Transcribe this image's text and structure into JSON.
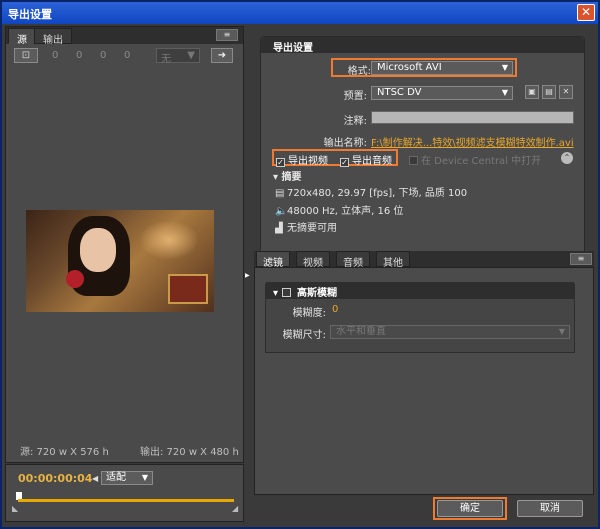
{
  "window": {
    "title": "导出设置",
    "close_glyph": "✕"
  },
  "left": {
    "tabs": [
      "源",
      "输出"
    ],
    "panel_menu_glyph": "≡",
    "crop_values": [
      "0",
      "0",
      "0",
      "0"
    ],
    "crop_ratio": "无",
    "source_size": "源: 720 w X 576 h",
    "output_size": "输出: 720 w X 480 h",
    "timecode": "00:00:00:04",
    "fit_select": "适配"
  },
  "export": {
    "section_title": "导出设置",
    "format_label": "格式:",
    "format_value": "Microsoft AVI",
    "preset_label": "预置:",
    "preset_value": "NTSC DV",
    "comment_label": "注释:",
    "output_name_label": "输出名称:",
    "output_name_value": "F:\\制作解决...特效\\视频滤支模糊特效制作.avi",
    "export_video_label": "导出视频",
    "export_audio_label": "导出音频",
    "device_central_label": "在 Device Central 中打开",
    "summary_title": "摘要",
    "summary_video": "720x480, 29.97 [fps], 下场, 品质 100",
    "summary_audio": "48000 Hz, 立体声, 16 位",
    "summary_none": "无摘要可用"
  },
  "tabs2": [
    "滤镜",
    "视频",
    "音频",
    "其他"
  ],
  "filter": {
    "name": "高斯模糊",
    "blur_label": "模糊度:",
    "blur_value": "0",
    "dimension_label": "模糊尺寸:",
    "dimension_value": "水平和垂直"
  },
  "buttons": {
    "ok": "确定",
    "cancel": "取消"
  },
  "colors": {
    "highlight": "#f07a30",
    "timecode": "#e8b341",
    "link": "#e8a62a"
  }
}
